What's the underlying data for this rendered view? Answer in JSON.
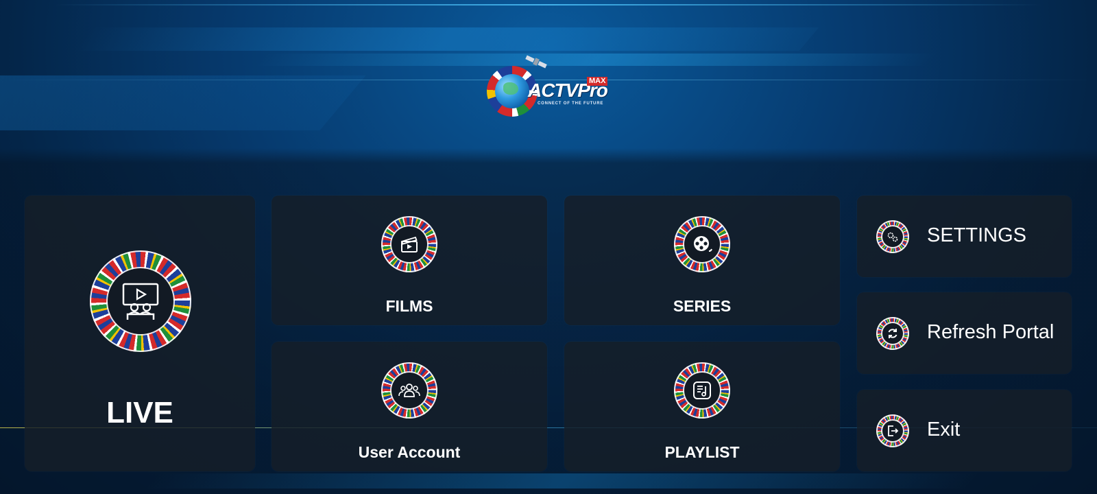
{
  "app": {
    "logo_text": "ACTVPro",
    "logo_badge": "MAX",
    "logo_tagline": "CONNECT OF THE FUTURE"
  },
  "tiles": {
    "live": {
      "label": "LIVE",
      "icon": "live-tv-icon"
    },
    "films": {
      "label": "FILMS",
      "icon": "clapperboard-icon"
    },
    "series": {
      "label": "SERIES",
      "icon": "film-reel-icon"
    },
    "user_account": {
      "label": "User Account",
      "icon": "users-icon"
    },
    "playlist": {
      "label": "PLAYLIST",
      "icon": "playlist-icon"
    }
  },
  "side_menu": [
    {
      "label": "SETTINGS",
      "icon": "gears-icon"
    },
    {
      "label": "Refresh Portal",
      "icon": "refresh-icon"
    },
    {
      "label": "Exit",
      "icon": "exit-icon"
    }
  ],
  "colors": {
    "background": "#04172e",
    "tile": "#161e28",
    "accent": "#0a5a9c",
    "text": "#ffffff"
  }
}
